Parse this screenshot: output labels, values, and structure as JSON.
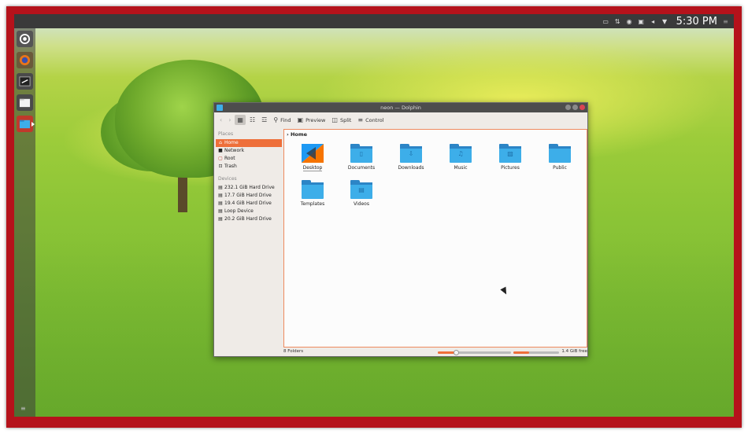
{
  "topbar": {
    "tray_icons": [
      "keyboard-icon",
      "network-icon",
      "record-icon",
      "battery-icon",
      "volume-icon",
      "menu-arrow-icon"
    ],
    "clock": "5:30 PM"
  },
  "launcher": {
    "items": [
      "settings-icon",
      "firefox-icon",
      "terminal-icon",
      "files-icon",
      "dolphin-icon"
    ]
  },
  "window": {
    "title": "neon — Dolphin",
    "toolbar": {
      "find": "Find",
      "preview": "Preview",
      "split": "Split",
      "control": "Control"
    },
    "sidebar": {
      "places_header": "Places",
      "places": [
        {
          "label": "Home",
          "icon": "home-icon"
        },
        {
          "label": "Network",
          "icon": "network-icon"
        },
        {
          "label": "Root",
          "icon": "root-icon"
        },
        {
          "label": "Trash",
          "icon": "trash-icon"
        }
      ],
      "devices_header": "Devices",
      "devices": [
        {
          "label": "232.1 GiB Hard Drive"
        },
        {
          "label": "17.7 GiB Hard Drive"
        },
        {
          "label": "19.4 GiB Hard Drive"
        },
        {
          "label": "Loop Device"
        },
        {
          "label": "20.2 GiB Hard Drive"
        }
      ]
    },
    "breadcrumb": {
      "location": "Home"
    },
    "items": [
      {
        "label": "Desktop",
        "icon": "desktop-folder-icon"
      },
      {
        "label": "Documents",
        "icon": "documents-folder-icon"
      },
      {
        "label": "Downloads",
        "icon": "downloads-folder-icon"
      },
      {
        "label": "Music",
        "icon": "music-folder-icon"
      },
      {
        "label": "Pictures",
        "icon": "pictures-folder-icon"
      },
      {
        "label": "Public",
        "icon": "public-folder-icon"
      },
      {
        "label": "Templates",
        "icon": "templates-folder-icon"
      },
      {
        "label": "Videos",
        "icon": "videos-folder-icon"
      }
    ],
    "statusbar": {
      "count": "8 Folders",
      "zoom_fraction": 0.25,
      "disk_used_fraction": 0.35,
      "free": "1.4 GiB free"
    }
  },
  "colors": {
    "accent": "#ee6f3a",
    "folder": "#3daee9",
    "frame": "#b5121b"
  }
}
